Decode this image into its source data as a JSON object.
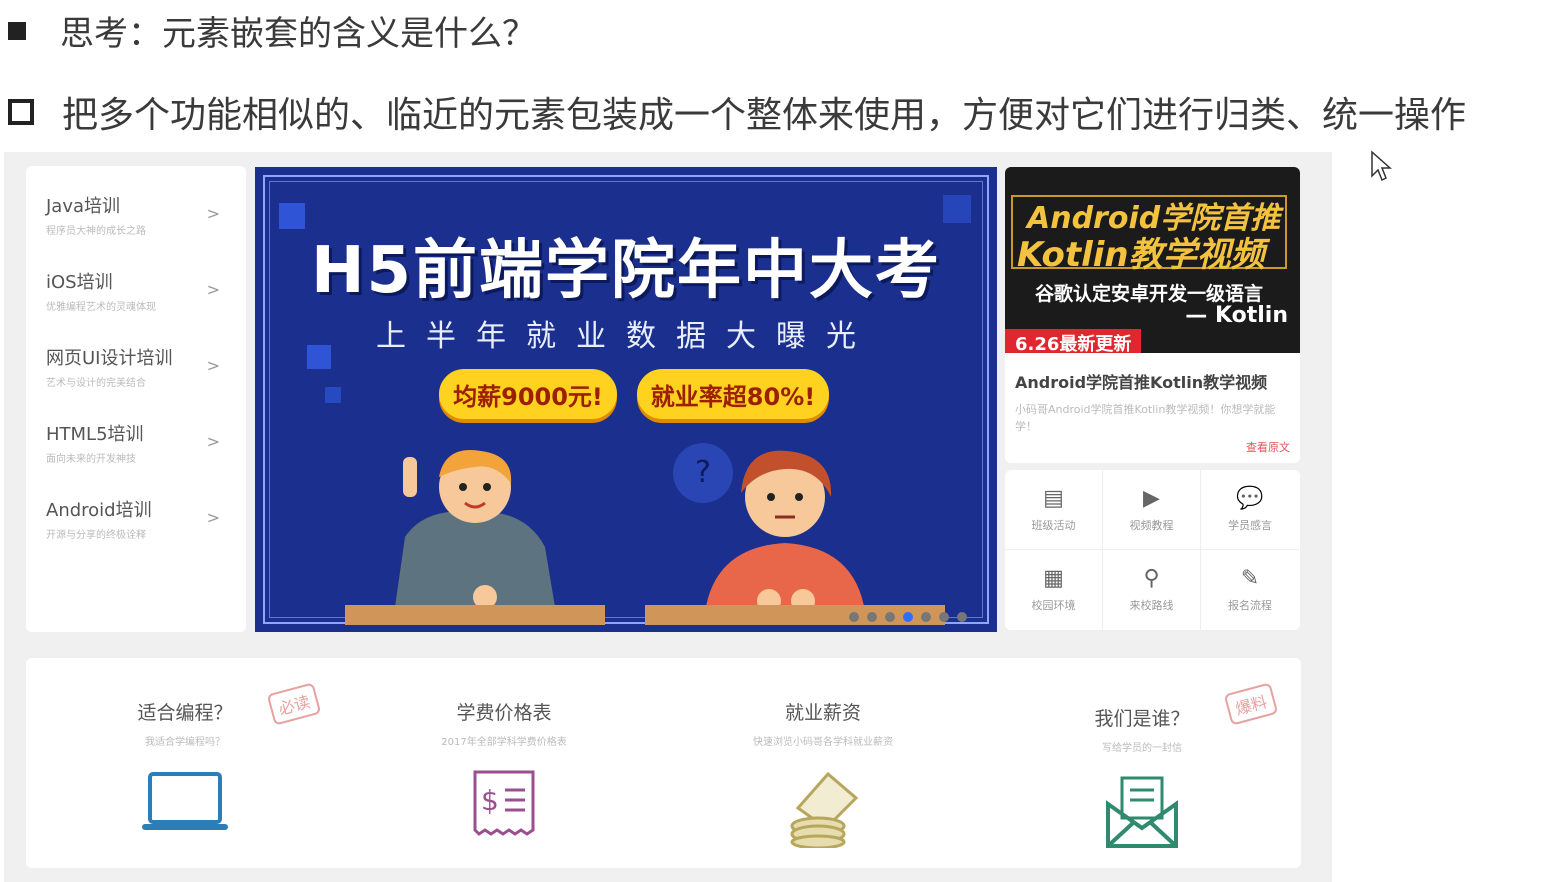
{
  "slide": {
    "question": "思考：元素嵌套的含义是什么？",
    "answer": "把多个功能相似的、临近的元素包装成一个整体来使用，方便对它们进行归类、统一操作"
  },
  "menu": {
    "items": [
      {
        "title": "Java培训",
        "sub": "程序员大神的成长之路",
        "arrow": ">"
      },
      {
        "title": "iOS培训",
        "sub": "优雅编程艺术的灵魂体现",
        "arrow": ">"
      },
      {
        "title": "网页UI设计培训",
        "sub": "艺术与设计的完美结合",
        "arrow": ">"
      },
      {
        "title": "HTML5培训",
        "sub": "面向未来的开发神技",
        "arrow": ">"
      },
      {
        "title": "Android培训",
        "sub": "开源与分享的终极诠释",
        "arrow": ">"
      }
    ]
  },
  "banner": {
    "title": "H5前端学院年中大考",
    "subtitle": "上半年就业数据大曝光",
    "pill_left": "均薪9000元!",
    "pill_right": "就业率超80%!",
    "question_mark": "?"
  },
  "promo": {
    "line1": "Android学院首推",
    "line2": "Kotlin教学视频",
    "line3": "谷歌认定安卓开发一级语言",
    "line4": "— Kotlin",
    "tag": "6.26最新更新",
    "title": "Android学院首推Kotlin教学视频",
    "desc": "小码哥Android学院首推Kotlin教学视频！你想学就能学！",
    "more": "查看原文"
  },
  "quick_links": [
    {
      "label": "班级活动",
      "icon": "calendar-icon",
      "glyph": "▤"
    },
    {
      "label": "视频教程",
      "icon": "video-icon",
      "glyph": "▶"
    },
    {
      "label": "学员感言",
      "icon": "comment-icon",
      "glyph": "💬"
    },
    {
      "label": "校园环境",
      "icon": "building-icon",
      "glyph": "▦"
    },
    {
      "label": "来校路线",
      "icon": "route-icon",
      "glyph": "⚲"
    },
    {
      "label": "报名流程",
      "icon": "form-icon",
      "glyph": "✎"
    }
  ],
  "features": [
    {
      "title": "适合编程？",
      "desc": "我适合学编程吗？",
      "stamp": "必读",
      "icon": "laptop-icon"
    },
    {
      "title": "学费价格表",
      "desc": "2017年全部学科学费价格表",
      "stamp": "",
      "icon": "price-list-icon"
    },
    {
      "title": "就业薪资",
      "desc": "快速浏览小码哥各学科就业薪资",
      "stamp": "",
      "icon": "coins-icon"
    },
    {
      "title": "我们是谁？",
      "desc": "写给学员的一封信",
      "stamp": "爆料",
      "icon": "envelope-icon"
    }
  ],
  "colors": {
    "banner_bg": "#1a2f8e",
    "accent_yellow": "#ffd21f",
    "promo_gold": "#f3c340",
    "tag_red": "#e0262e",
    "laptop_blue": "#2a7fb8",
    "price_purple": "#9b4f8e",
    "coin_olive": "#b7a75c",
    "envelope_green": "#2f8a6e"
  }
}
